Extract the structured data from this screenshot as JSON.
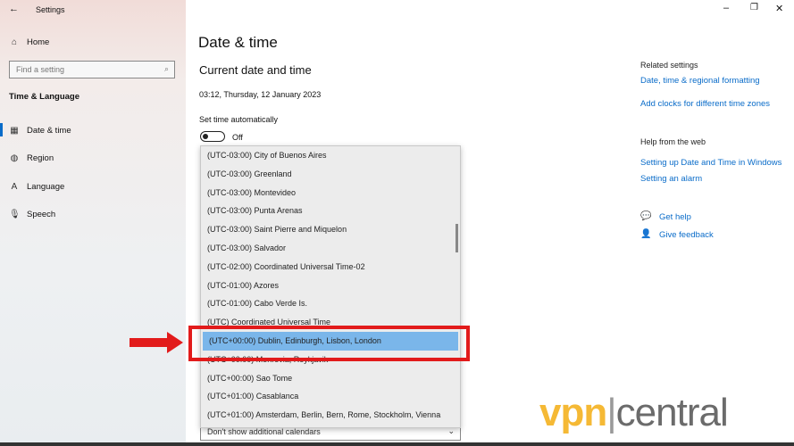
{
  "window": {
    "title": "Settings",
    "back_icon": "arrow-left-icon",
    "minimize_icon": "minimize-icon",
    "restore_icon": "restore-icon",
    "close_icon": "close-icon"
  },
  "sidebar": {
    "home": "Home",
    "search_placeholder": "Find a setting",
    "section": "Time & Language",
    "items": [
      {
        "label": "Date & time",
        "icon": "calendar-clock-icon",
        "active": true
      },
      {
        "label": "Region",
        "icon": "globe-icon"
      },
      {
        "label": "Language",
        "icon": "language-icon"
      },
      {
        "label": "Speech",
        "icon": "microphone-icon"
      }
    ]
  },
  "main": {
    "title": "Date & time",
    "subtitle": "Current date and time",
    "datetime": "03:12, Thursday, 12 January 2023",
    "auto_label": "Set time automatically",
    "auto_state": "Off",
    "calendar_value": "Don't show additional calendars"
  },
  "timezones": {
    "selected": "(UTC+00:00) Dublin, Edinburgh, Lisbon, London",
    "items": [
      "(UTC-03:00) City of Buenos Aires",
      "(UTC-03:00) Greenland",
      "(UTC-03:00) Montevideo",
      "(UTC-03:00) Punta Arenas",
      "(UTC-03:00) Saint Pierre and Miquelon",
      "(UTC-03:00) Salvador",
      "(UTC-02:00) Coordinated Universal Time-02",
      "(UTC-01:00) Azores",
      "(UTC-01:00) Cabo Verde Is.",
      "(UTC) Coordinated Universal Time",
      "(UTC+00:00) Dublin, Edinburgh, Lisbon, London",
      "(UTC+00:00) Monrovia, Reykjavik",
      "(UTC+00:00) Sao Tome",
      "(UTC+01:00) Casablanca",
      "(UTC+01:00) Amsterdam, Berlin, Bern, Rome, Stockholm, Vienna"
    ]
  },
  "related": {
    "heading": "Related settings",
    "links": [
      "Date, time & regional formatting",
      "Add clocks for different time zones"
    ]
  },
  "help": {
    "heading": "Help from the web",
    "links": [
      "Setting up Date and Time in Windows",
      "Setting an alarm"
    ],
    "get_help": "Get help",
    "feedback": "Give feedback"
  },
  "watermark": {
    "text": "vpncentral",
    "colors": {
      "vpn": "#f5b935",
      "central": "#6b6b6b"
    }
  },
  "annotation": {
    "color": "#e21b1b"
  }
}
